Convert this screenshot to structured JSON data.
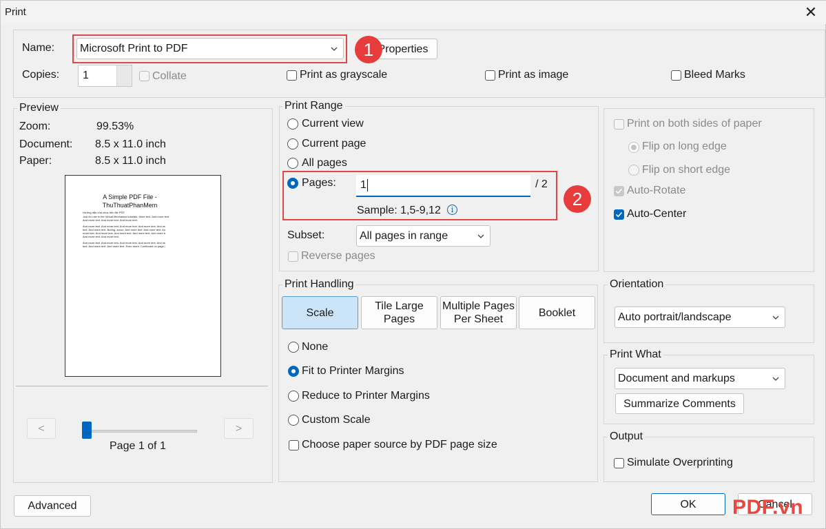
{
  "window": {
    "title": "Print",
    "close_glyph": "✕"
  },
  "printer": {
    "name_label": "Name:",
    "selected": "Microsoft Print to PDF",
    "properties_label": "Properties",
    "copies_label": "Copies:",
    "copies_value": "1",
    "collate_label": "Collate",
    "grayscale_label": "Print as grayscale",
    "image_label": "Print as image",
    "bleed_label": "Bleed Marks"
  },
  "preview": {
    "legend": "Preview",
    "zoom_label": "Zoom:",
    "zoom_value": "99.53%",
    "document_label": "Document:",
    "document_value": "8.5 x 11.0 inch",
    "paper_label": "Paper:",
    "paper_value": "8.5 x 11.0 inch",
    "page_title_line1": "A Simple PDF File -",
    "page_title_line2": "ThuThuatPhanMem",
    "page_lines": [
      "Hướng dẫn của chúc trên file PDF",
      "Just for use in the Virtual Mechanics tutorials. More text. And more text.",
      "And more text. And more text. And more text.",
      "And more text. And more text. And more text. And more text. And more",
      "text. And more text. Boring, zzzzz. And more text. And more text. And",
      "more text. And more text. And more text. And more text. And more text.",
      "And more text. And more text.",
      "And more text. And more text. And more text. And more text. And more",
      "text. And more text. And more text. Even more. Continued on page 2 ..."
    ],
    "prev_label": "<",
    "next_label": ">",
    "page_indicator": "Page 1 of 1",
    "slider_position": 0
  },
  "print_range": {
    "legend": "Print Range",
    "current_view": "Current view",
    "current_page": "Current page",
    "all_pages": "All pages",
    "pages_label": "Pages:",
    "pages_value": "1",
    "pages_total": "/ 2",
    "sample": "Sample: 1,5-9,12",
    "info_glyph": "i",
    "subset_label": "Subset:",
    "subset_value": "All pages in range",
    "reverse_label": "Reverse pages"
  },
  "duplex": {
    "both_sides": "Print on both sides of paper",
    "flip_long": "Flip on long edge",
    "flip_short": "Flip on short edge",
    "auto_rotate": "Auto-Rotate",
    "auto_center": "Auto-Center"
  },
  "handling": {
    "legend": "Print Handling",
    "tabs": [
      "Scale",
      "Tile Large\nPages",
      "Multiple Pages\nPer Sheet",
      "Booklet"
    ],
    "none": "None",
    "fit": "Fit to Printer Margins",
    "reduce": "Reduce to Printer Margins",
    "custom": "Custom Scale",
    "paper_source": "Choose paper source by PDF page size"
  },
  "orientation": {
    "legend": "Orientation",
    "value": "Auto portrait/landscape"
  },
  "print_what": {
    "legend": "Print What",
    "value": "Document and markups",
    "summarize_label": "Summarize Comments"
  },
  "output": {
    "legend": "Output",
    "simulate_label": "Simulate Overprinting"
  },
  "footer": {
    "advanced_label": "Advanced",
    "ok_label": "OK",
    "cancel_label": "Cancel"
  },
  "annotations": {
    "badge1": "1",
    "badge2": "2"
  },
  "watermark": {
    "text": "PDF.vn"
  },
  "colors": {
    "accent": "#0067c0",
    "highlight": "#e04646",
    "selected_tab": "#cce4f7"
  }
}
